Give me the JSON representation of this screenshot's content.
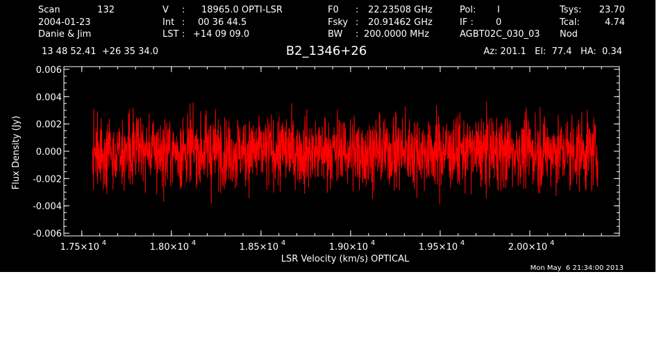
{
  "header": {
    "col1": [
      "Scan",
      "2004-01-23",
      "Danie & Jim"
    ],
    "col1_value": [
      "132",
      "",
      ""
    ],
    "col2_label": [
      "V",
      "Int",
      "LST"
    ],
    "col2_value": [
      "18965.0 OPTI-LSR",
      "00 36 44.5",
      "+14 09 09.0"
    ],
    "col3_label": [
      "F0",
      "Fsky",
      "BW"
    ],
    "col3_value": [
      "22.23508 GHz",
      "20.91462 GHz",
      "200.0000 MHz"
    ],
    "col4_label": [
      "Pol:",
      "IF :",
      "AGBT02C_030_03"
    ],
    "col4_value": [
      "I",
      "0",
      ""
    ],
    "col5_label": [
      "Tsys:",
      "Tcal:",
      "Nod"
    ],
    "col5_value": [
      "23.70",
      "4.74",
      ""
    ],
    "coords": "13 48 52.41  +26 35 34.0",
    "source": "B2_1346+26",
    "az_el_ha": "Az: 201.1   El:  77.4   HA:  0.34",
    "timestamp": "Mon May  6 21:34:00 2013"
  },
  "colors": {
    "background": "#000000",
    "axes": "#ffffff",
    "trace": "#ff0000"
  },
  "chart_data": {
    "type": "line",
    "xlabel": "LSR Velocity (km/s) OPTICAL",
    "ylabel": "Flux Density (Jy)",
    "xlim": [
      17400,
      20500
    ],
    "ylim": [
      -0.0062,
      0.0062
    ],
    "x_ticks": [
      17500,
      18000,
      18500,
      19000,
      19500,
      20000
    ],
    "x_tick_labels": [
      "1.75",
      "1.80",
      "1.85",
      "1.90",
      "1.95",
      "2.00"
    ],
    "x_tick_mult": "×10",
    "x_tick_exp": "4",
    "y_ticks": [
      -0.006,
      -0.004,
      -0.002,
      0.0,
      0.002,
      0.004,
      0.006
    ],
    "y_tick_labels": [
      "-0.006",
      "-0.004",
      "-0.002",
      "0.000",
      "0.002",
      "0.004",
      "0.006"
    ],
    "series": [
      {
        "x_start": 17560,
        "x_end": 20380,
        "noise_rms": 0.0013,
        "mean": 0.0,
        "min_value": -0.0058,
        "max_value": 0.0048
      }
    ]
  }
}
